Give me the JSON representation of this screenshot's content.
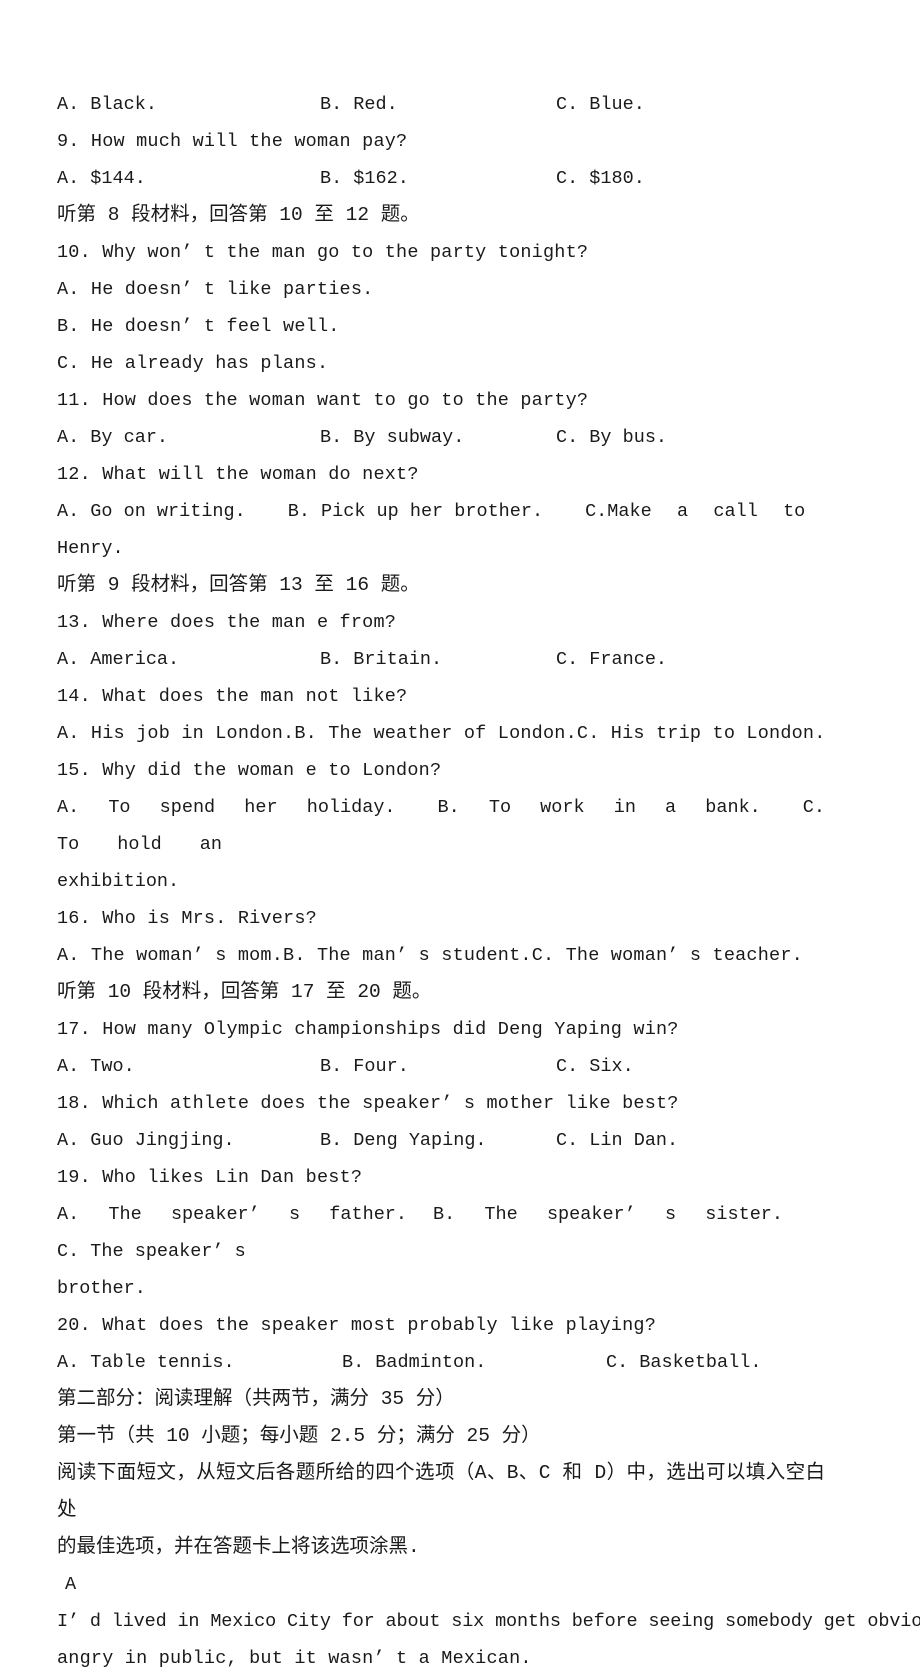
{
  "document": {
    "language": "mixed-zh-en",
    "type": "english-exam-paper-page"
  },
  "listening_section": {
    "questions": [
      {
        "id": "q8-options",
        "kind": "options",
        "a": "A. Black.",
        "b": "B. Red.",
        "c": "C. Blue."
      },
      {
        "id": "q9",
        "kind": "stem",
        "text": "9. How much will the woman pay?"
      },
      {
        "id": "q9-options",
        "kind": "options",
        "a": "A. $144.",
        "b": "B. $162.",
        "c": "C. $180."
      },
      {
        "id": "dir8",
        "kind": "direction",
        "text": "听第 8 段材料，回答第 10 至 12 题。"
      },
      {
        "id": "q10",
        "kind": "stem",
        "text": "10. Why won’ t the man go to the party tonight?"
      },
      {
        "id": "q10-a",
        "kind": "single",
        "text": "A. He doesn’ t like parties."
      },
      {
        "id": "q10-b",
        "kind": "single",
        "text": "B. He doesn’ t feel well."
      },
      {
        "id": "q10-c",
        "kind": "single",
        "text": "C. He already has plans."
      },
      {
        "id": "q11",
        "kind": "stem",
        "text": "11. How does the woman want to go to the party?"
      },
      {
        "id": "q11-options",
        "kind": "options",
        "a": "A. By car.",
        "b": "B. By subway.",
        "c": "C. By bus."
      },
      {
        "id": "q12",
        "kind": "stem",
        "text": "12. What will the woman do next?"
      },
      {
        "id": "q12-options",
        "kind": "options-wrapped",
        "a": "A. Go on writing.",
        "b": "B. Pick up her brother.",
        "c_head": "C.",
        "c_stretch": "Make a call to",
        "c_tail": "Henry."
      },
      {
        "id": "dir9",
        "kind": "direction",
        "text": "听第 9 段材料，回答第 13 至 16 题。"
      },
      {
        "id": "q13",
        "kind": "stem",
        "text": "13. Where does the man e from?"
      },
      {
        "id": "q13-options",
        "kind": "options",
        "a": "A. America.",
        "b": "B. Britain.",
        "c": "C. France."
      },
      {
        "id": "q14",
        "kind": "stem",
        "text": "14. What does the man not like?"
      },
      {
        "id": "q14-options",
        "kind": "options-tight",
        "a": "A. His job in London.",
        "b": "B. The weather of London.",
        "c": "C. His trip to London."
      },
      {
        "id": "q15",
        "kind": "stem",
        "text": "15. Why did the woman e to London?"
      },
      {
        "id": "q15-options",
        "kind": "options-wrapped",
        "a": "A. To spend her holiday.",
        "b": "B. To work in a bank.",
        "c_head": "C.",
        "c_stretch": "To hold an",
        "c_tail": "exhibition."
      },
      {
        "id": "q16",
        "kind": "stem",
        "text": "16. Who is Mrs. Rivers?"
      },
      {
        "id": "q16-options",
        "kind": "options-tight",
        "a": "A. The woman’ s mom.",
        "b": "B. The man’ s student.",
        "c": "C. The woman’ s teacher."
      },
      {
        "id": "dir10",
        "kind": "direction",
        "text": "听第 10 段材料，回答第 17 至 20 题。"
      },
      {
        "id": "q17",
        "kind": "stem",
        "text": "17. How many Olympic championships did Deng Yaping win?"
      },
      {
        "id": "q17-options",
        "kind": "options",
        "a": "A. Two.",
        "b": "B. Four.",
        "c": "C. Six."
      },
      {
        "id": "q18",
        "kind": "stem",
        "text": "18. Which athlete does the speaker’ s mother like best?"
      },
      {
        "id": "q18-options",
        "kind": "options",
        "a": "A. Guo Jingjing.",
        "b": "B. Deng Yaping.",
        "c": "C. Lin Dan."
      },
      {
        "id": "q19",
        "kind": "stem",
        "text": "19. Who likes Lin Dan best?"
      },
      {
        "id": "q19-options",
        "kind": "options-wrapped",
        "a": "A. The speaker’ s father.",
        "b": "B. The speaker’ s sister.",
        "c_head": "C. The speaker’ s",
        "c_stretch": "",
        "c_tail": "brother."
      },
      {
        "id": "q20",
        "kind": "stem",
        "text": "20. What does the speaker most probably like playing?"
      },
      {
        "id": "q20-options",
        "kind": "options",
        "a": "A. Table tennis.",
        "b": "B. Badminton.",
        "c": "C. Basketball."
      }
    ]
  },
  "reading_section": {
    "part_heading": "第二部分：阅读理解（共两节，满分 35 分）",
    "subsection_heading": "第一节（共 10 小题；每小题 2.5 分；满分 25 分）",
    "instructions_line1": "阅读下面短文，从短文后各题所给的四个选项（A、B、C 和 D）中，选出可以填入空白处",
    "instructions_line2": "的最佳选项，并在答题卡上将该选项涂黑.",
    "passage_label": "A",
    "passage_line1": "I’ d lived in Mexico City for about six months before seeing somebody get obviously",
    "passage_line2": "angry in public, but it wasn’ t a Mexican."
  }
}
